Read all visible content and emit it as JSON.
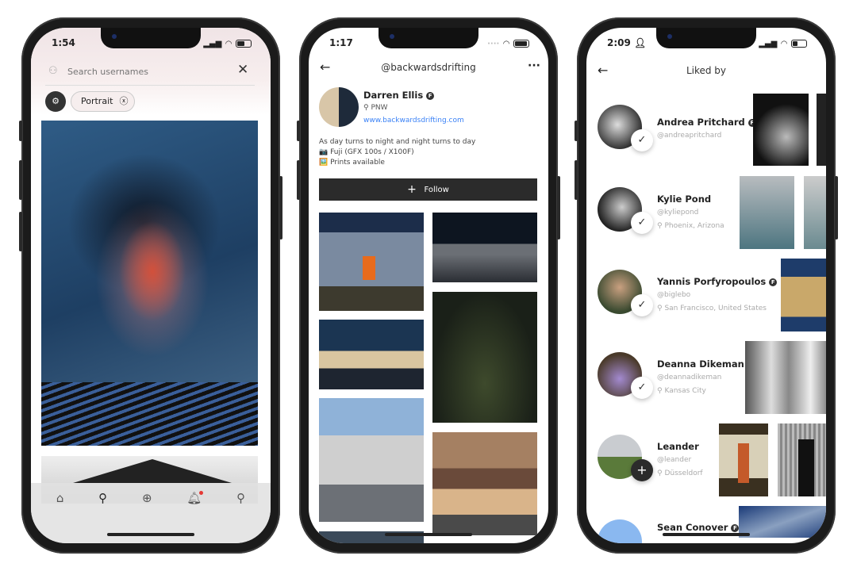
{
  "phone1": {
    "time": "1:54",
    "search_placeholder": "Search usernames",
    "filter_chip": "Portrait",
    "tabs": [
      {
        "icon": "home-icon"
      },
      {
        "icon": "search-icon"
      },
      {
        "icon": "add-circle-icon"
      },
      {
        "icon": "bell-icon",
        "has_notification": true
      },
      {
        "icon": "user-icon"
      }
    ],
    "notification_color": "#e53935"
  },
  "phone2": {
    "time": "1:17",
    "header_title": "@backwardsdrifting",
    "profile": {
      "name": "Darren Ellis",
      "location": "PNW",
      "website": "www.backwardsdrifting.com",
      "bio": [
        "As day turns to night and night turns to day",
        "📷 Fuji (GFX 100s / X100F)",
        "🖼️ Prints available"
      ]
    },
    "follow_label": "Follow",
    "link_color": "#3b82f6"
  },
  "phone3": {
    "time": "2:09",
    "header_title": "Liked by",
    "users": [
      {
        "name": "Andrea Pritchard",
        "handle": "@andreapritchard",
        "location": "",
        "verified": true,
        "following": true
      },
      {
        "name": "Kylie Pond",
        "handle": "@kyliepond",
        "location": "Phoenix, Arizona",
        "verified": false,
        "following": true
      },
      {
        "name": "Yannis Porfyropoulos",
        "handle": "@biglebo",
        "location": "San Francisco, United States",
        "verified": true,
        "following": true
      },
      {
        "name": "Deanna Dikeman",
        "handle": "@deannadikeman",
        "location": "Kansas City",
        "verified": false,
        "following": true
      },
      {
        "name": "Leander",
        "handle": "@leander",
        "location": "Düsseldorf",
        "verified": false,
        "following": false
      },
      {
        "name": "Sean Conover",
        "handle": "",
        "location": "",
        "verified": true,
        "following": false
      }
    ]
  }
}
